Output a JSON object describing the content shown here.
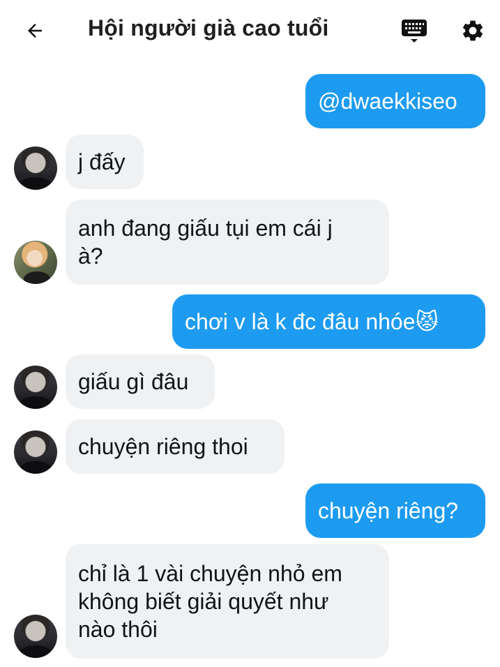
{
  "header": {
    "title": "Hội người già cao tuổi",
    "back_icon": "arrow-left-icon",
    "keyboard_icon": "keyboard-icon",
    "settings_icon": "gear-icon"
  },
  "colors": {
    "outgoing_bubble": "#1d9bf0",
    "incoming_bubble": "#eff1f3"
  },
  "messages": [
    {
      "direction": "outgoing",
      "lines": [
        "@dwaekkiseo"
      ]
    },
    {
      "direction": "incoming",
      "lines": [
        "j đấy"
      ]
    },
    {
      "direction": "incoming",
      "lines": [
        "anh đang giấu tụi em cái j",
        "à?"
      ]
    },
    {
      "direction": "outgoing",
      "lines": [
        "chơi v là k đc đâu nhóe😾"
      ]
    },
    {
      "direction": "incoming",
      "lines": [
        "giấu gì đâu"
      ]
    },
    {
      "direction": "incoming",
      "lines": [
        "chuyện riêng thoi"
      ]
    },
    {
      "direction": "outgoing",
      "lines": [
        "chuyện riêng?"
      ]
    },
    {
      "direction": "incoming",
      "lines": [
        "chỉ là 1 vài chuyện nhỏ em",
        "không biết giải quyết như",
        "nào thôi"
      ]
    }
  ]
}
